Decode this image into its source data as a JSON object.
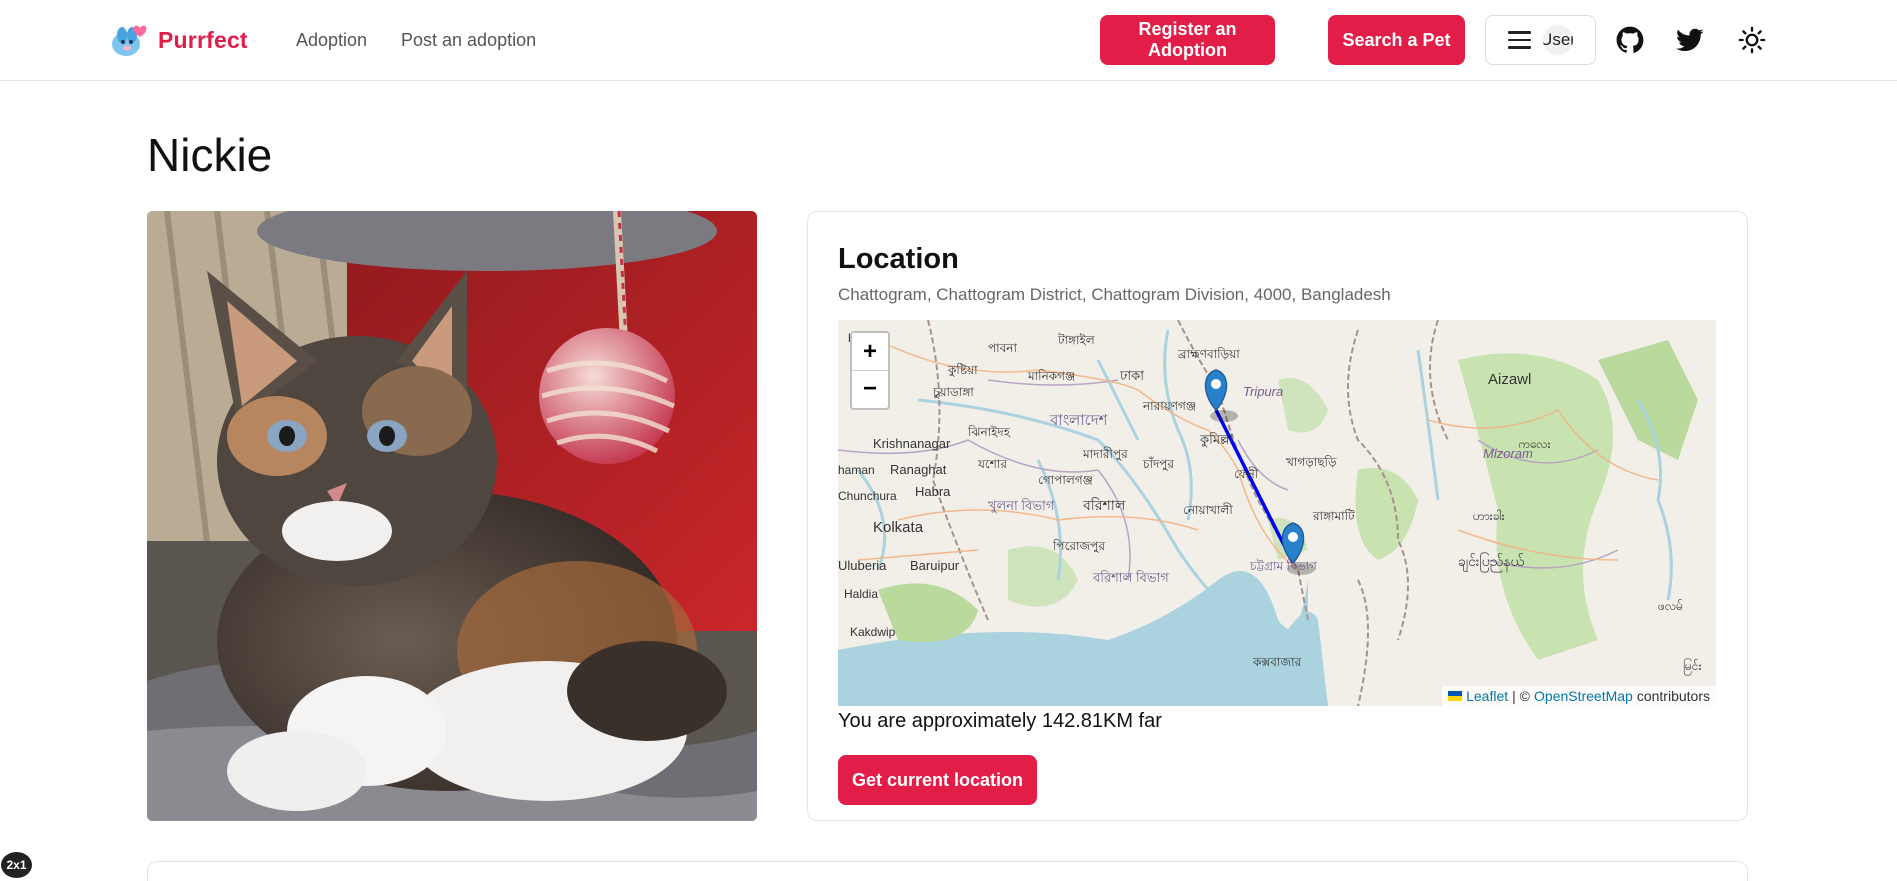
{
  "header": {
    "brand_name": "Purrfect",
    "nav": [
      "Adoption",
      "Post an adoption"
    ],
    "register_label": "Register an Adoption",
    "search_label": "Search a Pet",
    "user_avatar_text": "User",
    "icons": [
      "github-icon",
      "twitter-icon",
      "sun-icon"
    ]
  },
  "pet": {
    "name": "Nickie"
  },
  "location": {
    "title": "Location",
    "address": "Chattogram, Chattogram District, Chattogram Division, 4000, Bangladesh",
    "distance_text": "You are approximately 142.81KM far",
    "button_label": "Get current location"
  },
  "map": {
    "zoom_in": "+",
    "zoom_out": "−",
    "attribution_leaflet": "Leaflet",
    "attribution_sep": "| ©",
    "attribution_osm": "OpenStreetMap",
    "attribution_suffix": "contributors",
    "labels": [
      "Aizawl",
      "Tripura",
      "Mizoram",
      "ঢাকা",
      "বাংলাদেশ",
      "কুমিল্লা",
      "চট্টগ্রাম বিভাগ",
      "Krishnanagar",
      "Ranaghat",
      "Habra",
      "Kolkata",
      "Uluberia",
      "Baruipur",
      "Haldia",
      "Kakdwip",
      "Chunchura",
      "haman",
      "খুলনা বিভাগ",
      "বরিশাল",
      "বরিশাল বিভাগ",
      "পিরোজপুর",
      "গোপালগঞ্জ",
      "মাদারীপুর",
      "চাঁদপুর",
      "নোয়াখালী",
      "রাঙ্গামাটি",
      "খাগড়াছড়ি",
      "কক্সবাজার",
      "যশোর",
      "ঝিনাইদহ",
      "চুয়াডাঙ্গা",
      "কুষ্টিয়া",
      "পাবনা",
      "মানিকগঞ্জ",
      "নারায়ণগঞ্জ",
      "টাঙ্গাইল",
      "ব্রাহ্মণবাড়িয়া",
      "hapore",
      "ফেনী",
      "ချင်းပြည်နယ်",
      "ဟားခါး",
      "ကလေး",
      "ဖလမ်",
      "မြင်း"
    ],
    "route_color": "#0000ff",
    "marker_color": "#2a81cb"
  },
  "debug_badge": "2x1",
  "colors": {
    "accent": "#e11d48"
  }
}
